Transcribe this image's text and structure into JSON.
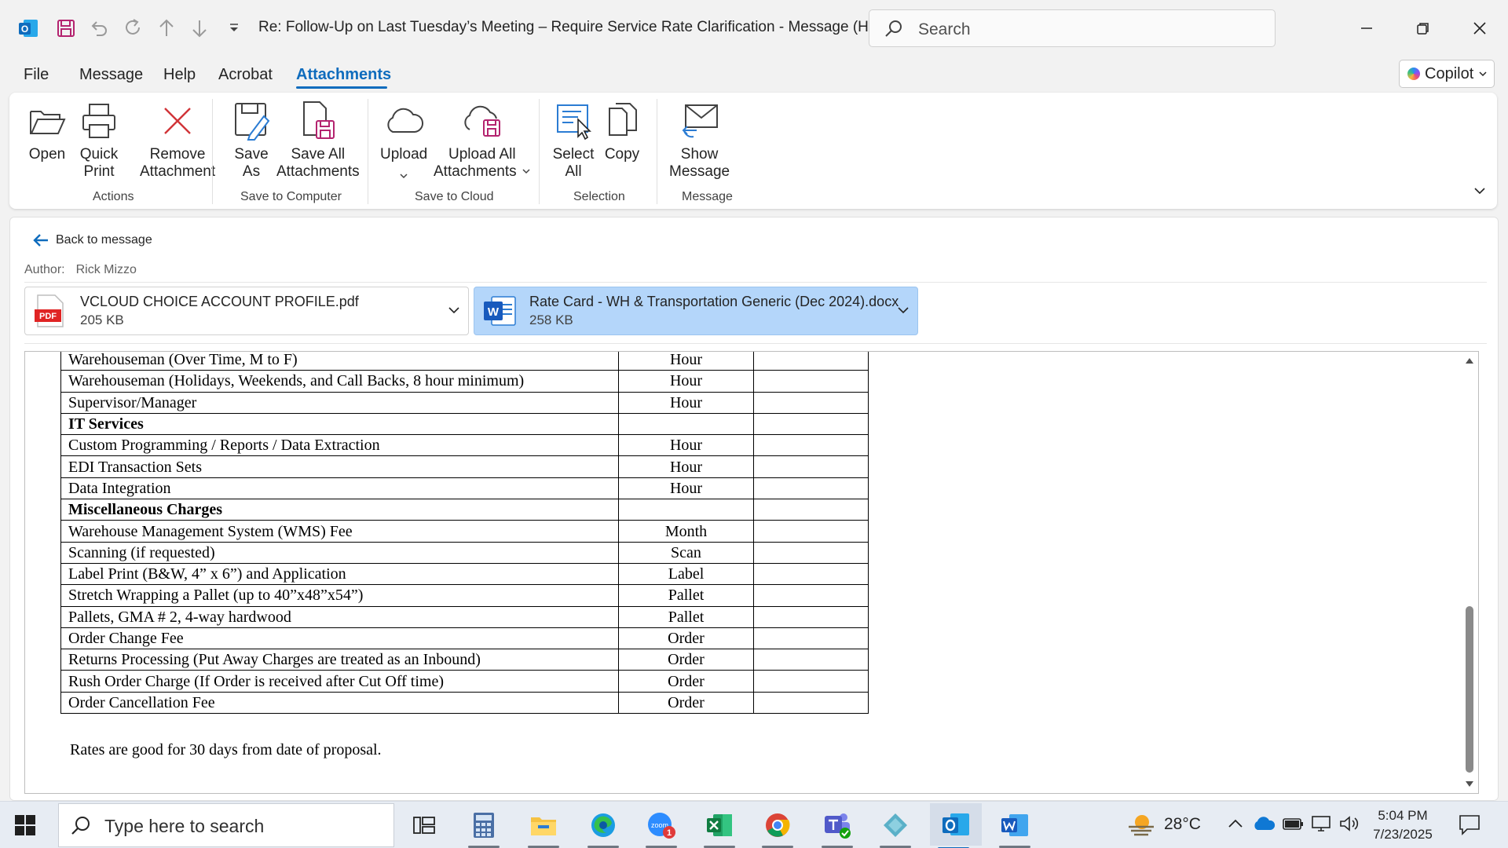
{
  "window": {
    "title": "Re: Follow-Up on Last Tuesday’s Meeting – Require Service Rate Clarification  -  Message (H...",
    "search_placeholder": "Search"
  },
  "menu": {
    "tabs": [
      "File",
      "Message",
      "Help",
      "Acrobat",
      "Attachments"
    ],
    "active_tab": "Attachments",
    "copilot_label": "Copilot"
  },
  "ribbon": {
    "buttons": {
      "open": [
        "Open",
        ""
      ],
      "quick_print": [
        "Quick",
        "Print"
      ],
      "remove": [
        "Remove",
        "Attachment"
      ],
      "save_as": [
        "Save",
        "As"
      ],
      "save_all": [
        "Save All",
        "Attachments"
      ],
      "upload": [
        "Upload",
        ""
      ],
      "upload_all": [
        "Upload All",
        "Attachments"
      ],
      "select_all": [
        "Select",
        "All"
      ],
      "copy": [
        "Copy",
        ""
      ],
      "show_message": [
        "Show",
        "Message"
      ]
    },
    "groups": {
      "actions": "Actions",
      "save_to_computer": "Save to Computer",
      "save_to_cloud": "Save to Cloud",
      "selection": "Selection",
      "message": "Message"
    }
  },
  "pane": {
    "back_label": "Back to message",
    "author_label": "Author:",
    "author_name": "Rick Mizzo",
    "attachments": [
      {
        "name": "VCLOUD CHOICE ACCOUNT PROFILE.pdf",
        "size": "205 KB",
        "type": "pdf",
        "icon_text": "PDF"
      },
      {
        "name": "Rate Card - WH & Transportation Generic (Dec 2024).docx",
        "size": "258 KB",
        "type": "word",
        "icon_text": "W"
      }
    ]
  },
  "document": {
    "rows": [
      {
        "service": "Warehouseman (Over Time, M to F)",
        "unit": "Hour",
        "heading": false
      },
      {
        "service": "Warehouseman (Holidays, Weekends, and Call Backs, 8 hour minimum)",
        "unit": "Hour",
        "heading": false
      },
      {
        "service": "Supervisor/Manager",
        "unit": "Hour",
        "heading": false
      },
      {
        "service": "IT Services",
        "unit": "",
        "heading": true
      },
      {
        "service": "Custom Programming / Reports / Data Extraction",
        "unit": "Hour",
        "heading": false
      },
      {
        "service": "EDI Transaction Sets",
        "unit": "Hour",
        "heading": false
      },
      {
        "service": "Data Integration",
        "unit": "Hour",
        "heading": false
      },
      {
        "service": "Miscellaneous Charges",
        "unit": "",
        "heading": true
      },
      {
        "service": "Warehouse Management System (WMS) Fee",
        "unit": "Month",
        "heading": false
      },
      {
        "service": "Scanning (if requested)",
        "unit": "Scan",
        "heading": false
      },
      {
        "service": "Label Print (B&W, 4” x 6”) and Application",
        "unit": "Label",
        "heading": false
      },
      {
        "service": "Stretch Wrapping a Pallet (up to 40”x48”x54”)",
        "unit": "Pallet",
        "heading": false
      },
      {
        "service": "Pallets, GMA # 2, 4-way hardwood",
        "unit": "Pallet",
        "heading": false
      },
      {
        "service": "Order Change Fee",
        "unit": "Order",
        "heading": false
      },
      {
        "service": "Returns Processing (Put Away Charges are treated as an Inbound)",
        "unit": "Order",
        "heading": false
      },
      {
        "service": "Rush Order Charge (If Order is received after Cut Off time)",
        "unit": "Order",
        "heading": false
      },
      {
        "service": "Order Cancellation Fee",
        "unit": "Order",
        "heading": false
      }
    ],
    "note": "Rates are good for 30 days from date of proposal."
  },
  "taskbar": {
    "search_placeholder": "Type here to search",
    "apps": [
      "task-view",
      "calculator",
      "file-explorer",
      "edge",
      "zoom",
      "excel",
      "chrome",
      "teams",
      "app-diamond",
      "outlook",
      "word"
    ],
    "active_app": "outlook",
    "zoom_badge": "1",
    "weather": "28°C",
    "time": "5:04 PM",
    "date": "7/23/2025"
  },
  "colors": {
    "accent": "#0f6cbd",
    "selected_attachment": "#b4d6fa",
    "remove_red": "#d13438",
    "pdf_red": "#e02424",
    "word_blue": "#185abd"
  }
}
